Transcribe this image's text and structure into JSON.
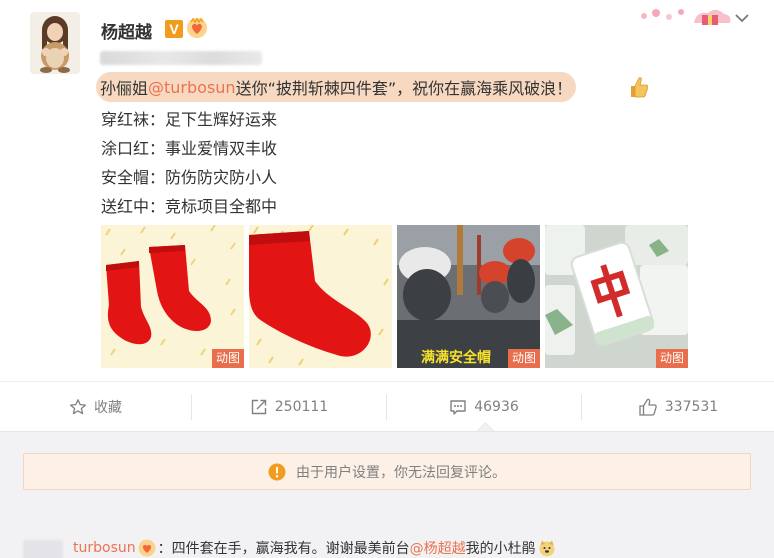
{
  "post": {
    "author": "杨超越",
    "verified_mark": "V",
    "headline": {
      "prefix": "孙俪姐",
      "mention": "@turbosun",
      "suffix": " 送你“披荆斩棘四件套”，祝你在赢海乘风破浪！"
    },
    "lines": [
      "穿红袜：足下生辉好运来",
      "涂口红：事业爱情双丰收",
      "安全帽：防伤防灾防小人",
      "送红中：竞标项目全都中"
    ],
    "media": [
      {
        "icon": "red-socks-image",
        "gif_label": "动图"
      },
      {
        "icon": "red-sock-closeup-image",
        "gif_label": ""
      },
      {
        "icon": "safety-helmet-image",
        "gif_label": "动图",
        "caption": "满满安全帽"
      },
      {
        "icon": "mahjong-hongzhong-image",
        "gif_label": "动图"
      }
    ]
  },
  "actions": {
    "favorite_label": "收藏",
    "repost_count": "250111",
    "comment_count": "46936",
    "like_count": "337531"
  },
  "notice": {
    "text": "由于用户设置，你无法回复评论。"
  },
  "comment": {
    "name": "turbosun",
    "text_before": "：四件套在手，赢海我有。谢谢最美前台 ",
    "mention": "@杨超越",
    "text_after": " 我的小杜鹃"
  },
  "colors": {
    "link": "#eb7350",
    "headline_highlight": "#f7d9c1",
    "gif_tag": "#e96f4c",
    "notice_bg": "#fdf0e6",
    "notice_icon": "#f29c1f"
  }
}
